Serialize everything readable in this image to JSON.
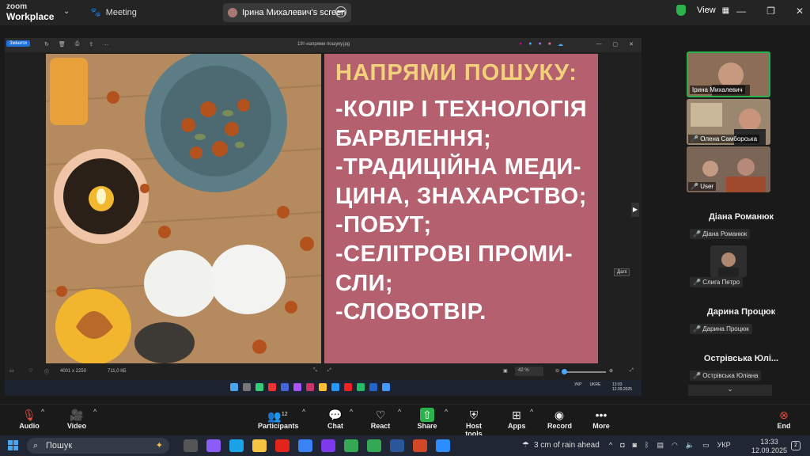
{
  "zoom": {
    "logo_top": "zoom",
    "logo_bottom": "Workplace",
    "meeting_label": "Meeting",
    "share_tab": "Ірина Михалевич's screen",
    "view_label": "View"
  },
  "viewer": {
    "edit_label": "Змінити",
    "file_name": "19т-напрями пошуку.jpg",
    "dims": "4001 x 2250",
    "file_size": "711,0 КБ",
    "zoom_level": "42 %",
    "tooltip": "Далі",
    "tray_lang": "УКР",
    "tray_lang2": "UKRE",
    "tray_time": "13:03",
    "tray_date": "12.09.2025"
  },
  "slide": {
    "heading": "НАПРЯМИ ПОШУКУ:",
    "lines": [
      "-КОЛІР І ТЕХНОЛОГІЯ",
      "БАРВЛЕННЯ;",
      "-ТРАДИЦІЙНА МЕДИ-",
      "ЦИНА, ЗНАХАРСТВО;",
      "-ПОБУТ;",
      "-СЕЛІТРОВІ ПРОМИ-",
      "СЛИ;",
      "-СЛОВОТВІР."
    ]
  },
  "participants": {
    "tiles": [
      {
        "name": "Ірина Михалевич"
      },
      {
        "name": "Олена Самборська"
      },
      {
        "name": "User"
      }
    ],
    "cards": [
      {
        "title": "Діана Романюк",
        "label": "Діана Романюк"
      },
      {
        "title": "",
        "label": "Слига Петро"
      },
      {
        "title": "Дарина Процюк",
        "label": "Дарина Процюк"
      },
      {
        "title": "Острівська Юлі...",
        "label": "Острівська Юліана"
      }
    ]
  },
  "controls": {
    "audio": "Audio",
    "video": "Video",
    "participants": "Participants",
    "participants_count": "12",
    "chat": "Chat",
    "react": "React",
    "share": "Share",
    "host_tools": "Host tools",
    "apps": "Apps",
    "record": "Record",
    "more": "More",
    "end": "End"
  },
  "taskbar": {
    "search": "Пошук",
    "weather": "3 cm of rain ahead",
    "lang": "УКР",
    "time": "13:33",
    "date": "12.09.2025",
    "notif_count": "2"
  }
}
